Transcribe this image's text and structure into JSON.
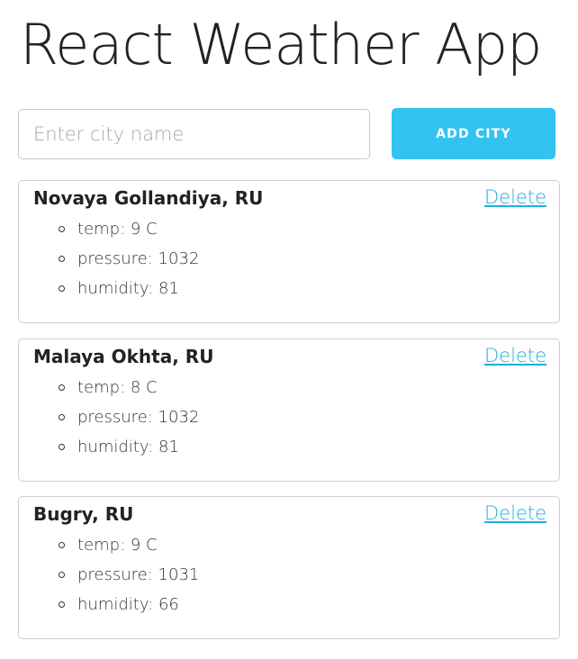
{
  "header": {
    "title": "React Weather App"
  },
  "form": {
    "placeholder": "Enter city name",
    "value": "",
    "button_label": "ADD CITY"
  },
  "colors": {
    "accent": "#33c3f0",
    "link": "#1eaedb",
    "border": "#cfcfcf",
    "text": "#222222"
  },
  "cities": [
    {
      "name": "Novaya Gollandiya, RU",
      "delete_label": "Delete",
      "stats": [
        "temp: 9 C",
        "pressure: 1032",
        "humidity: 81"
      ]
    },
    {
      "name": "Malaya Okhta, RU",
      "delete_label": "Delete",
      "stats": [
        "temp: 8 C",
        "pressure: 1032",
        "humidity: 81"
      ]
    },
    {
      "name": "Bugry, RU",
      "delete_label": "Delete",
      "stats": [
        "temp: 9 C",
        "pressure: 1031",
        "humidity: 66"
      ]
    }
  ]
}
